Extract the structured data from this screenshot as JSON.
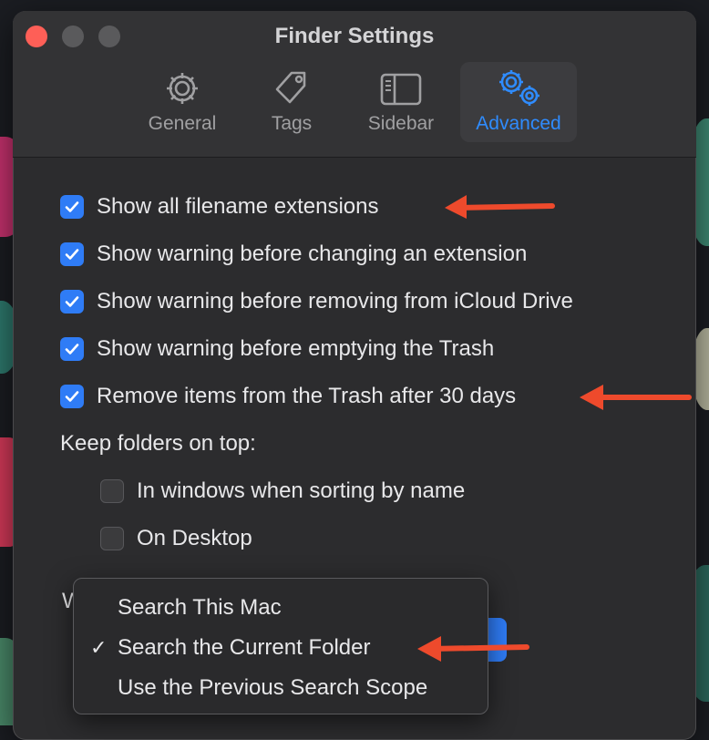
{
  "window": {
    "title": "Finder Settings"
  },
  "tabs": [
    {
      "label": "General",
      "icon": "gear-icon",
      "active": false
    },
    {
      "label": "Tags",
      "icon": "tag-icon",
      "active": false
    },
    {
      "label": "Sidebar",
      "icon": "sidebar-icon",
      "active": false
    },
    {
      "label": "Advanced",
      "icon": "gears-icon",
      "active": true
    }
  ],
  "options": [
    {
      "label": "Show all filename extensions",
      "checked": true
    },
    {
      "label": "Show warning before changing an extension",
      "checked": true
    },
    {
      "label": "Show warning before removing from iCloud Drive",
      "checked": true
    },
    {
      "label": "Show warning before emptying the Trash",
      "checked": true
    },
    {
      "label": "Remove items from the Trash after 30 days",
      "checked": true
    }
  ],
  "keep_folders": {
    "heading": "Keep folders on top:",
    "items": [
      {
        "label": "In windows when sorting by name",
        "checked": false
      },
      {
        "label": "On Desktop",
        "checked": false
      }
    ]
  },
  "search_label_partial": "W",
  "search_menu": {
    "items": [
      {
        "label": "Search This Mac",
        "selected": false
      },
      {
        "label": "Search the Current Folder",
        "selected": true
      },
      {
        "label": "Use the Previous Search Scope",
        "selected": false
      }
    ],
    "check_glyph": "✓"
  },
  "colors": {
    "accent": "#2f7cf6",
    "annotation_arrow": "#ee4a2c",
    "window_bg": "#2c2c2e"
  }
}
